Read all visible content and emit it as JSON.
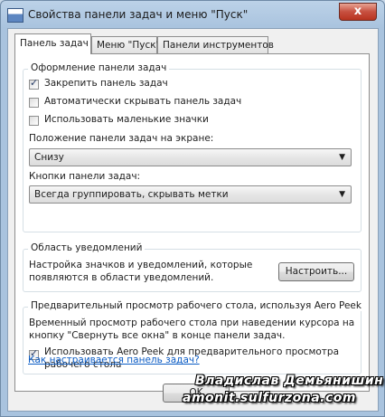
{
  "window": {
    "title": "Свойства панели задач и меню \"Пуск\"",
    "close_glyph": "x"
  },
  "tabs": [
    {
      "label": "Панель задач",
      "active": true
    },
    {
      "label": "Меню \"Пуск\"",
      "active": false
    },
    {
      "label": "Панели инструментов",
      "active": false
    }
  ],
  "appearance": {
    "legend": "Оформление панели задач",
    "checkboxes": [
      {
        "label": "Закрепить панель задач",
        "checked": true
      },
      {
        "label": "Автоматически скрывать панель задач",
        "checked": false
      },
      {
        "label": "Использовать маленькие значки",
        "checked": false
      }
    ],
    "position_label": "Положение панели задач на экране:",
    "position_value": "Снизу",
    "buttons_label": "Кнопки панели задач:",
    "buttons_value": "Всегда группировать, скрывать метки"
  },
  "notifications": {
    "legend": "Область уведомлений",
    "text_line1": "Настройка значков и уведомлений, которые",
    "text_line2": "появляются в области уведомлений.",
    "customize_button": "Настроить..."
  },
  "aero_peek": {
    "legend": "Предварительный просмотр рабочего стола, используя Aero Peek",
    "text_line1": "Временный просмотр рабочего стола при наведении курсора на",
    "text_line2": "кнопку \"Свернуть все окна\" в конце панели задач.",
    "checkbox_line1": "Использовать Aero Peek для предварительного просмотра",
    "checkbox_line2": "рабочего стола",
    "checked": true
  },
  "help_link": "Как настраивается панель задач?",
  "footer": {
    "ok_label": "OK"
  },
  "watermark": {
    "line1": "Владислав Демьянишин",
    "line2": "amonit.sulfurzona.com"
  }
}
